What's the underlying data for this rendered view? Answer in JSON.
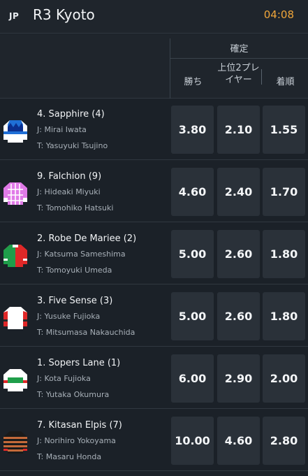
{
  "header": {
    "country": "JP",
    "race_title": "R3 Kyoto",
    "time": "04:08"
  },
  "columns": {
    "group": "確定",
    "win": "勝ち",
    "place": "上位2プレイヤー",
    "show": "着順"
  },
  "runners": [
    {
      "name": "4. Sapphire (4)",
      "jockey": "J: Mirai Iwata",
      "trainer": "T: Yasuyuki Tsujino",
      "win": "3.80",
      "place": "2.10",
      "show": "1.55",
      "silk": "sapphire-silk-icon"
    },
    {
      "name": "9. Falchion (9)",
      "jockey": "J: Hideaki Miyuki",
      "trainer": "T: Tomohiko Hatsuki",
      "win": "4.60",
      "place": "2.40",
      "show": "1.70",
      "silk": "falchion-silk-icon"
    },
    {
      "name": "2. Robe De Mariee (2)",
      "jockey": "J: Katsuma Sameshima",
      "trainer": "T: Tomoyuki Umeda",
      "win": "5.00",
      "place": "2.60",
      "show": "1.80",
      "silk": "robe-de-mariee-silk-icon"
    },
    {
      "name": "3. Five Sense (3)",
      "jockey": "J: Yusuke Fujioka",
      "trainer": "T: Mitsumasa Nakauchida",
      "win": "5.00",
      "place": "2.60",
      "show": "1.80",
      "silk": "five-sense-silk-icon"
    },
    {
      "name": "1. Sopers Lane (1)",
      "jockey": "J: Kota Fujioka",
      "trainer": "T: Yutaka Okumura",
      "win": "6.00",
      "place": "2.90",
      "show": "2.00",
      "silk": "sopers-lane-silk-icon"
    },
    {
      "name": "7. Kitasan Elpis (7)",
      "jockey": "J: Norihiro Yokoyama",
      "trainer": "T: Masaru Honda",
      "win": "10.00",
      "place": "4.60",
      "show": "2.80",
      "silk": "kitasan-elpis-silk-icon"
    }
  ],
  "colors": {
    "background": "#1b2128",
    "odds_button": "#2a3139",
    "time_accent": "#f0a63a"
  }
}
